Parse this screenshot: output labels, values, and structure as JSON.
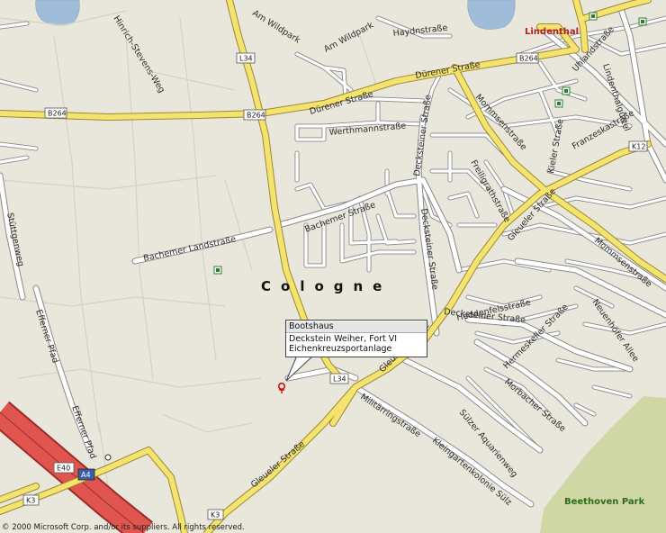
{
  "place": {
    "district": "Lindenthal",
    "city": "Cologne",
    "park": "Beethoven Park"
  },
  "callout": {
    "title": "Bootshaus",
    "line1": "Deckstein Weiher, Fort VI",
    "line2": "Eichenkreuzsportanlage"
  },
  "streets": {
    "haydn": "Haydnstraße",
    "am_wildpark_1": "Am Wildpark",
    "am_wildpark_2": "Am Wildpark",
    "hinrich": "Hinrich-Stevens-Weg",
    "dueren_1": "Dürener Straße",
    "dueren_2": "Dürener Straße",
    "wethmann": "Werthmannstraße",
    "deckstein_1": "Decksteiner Straße",
    "deckstein_2": "Decksteiner Straße",
    "deckstein_3": "Decksteiner Straße",
    "mommsen_1": "Mommsenstraße",
    "mommsen_2": "Mommsenstraße",
    "freiligrath": "Freiligrathstraße",
    "kieler": "Kieler Straße",
    "uhland": "Uhlandstraße",
    "lindenthal_guertel": "Lindenthalgürtel",
    "franzeska": "Franzeskastraße",
    "gleueler_1": "Gleueler Straße",
    "gleueler_2": "Gleueler Straße",
    "gleueler_3": "Gleueler Straße",
    "bachemer_1": "Bachemer Straße",
    "bachemer_landstr": "Bachemer Landstraße",
    "stueting": "Stüttgenweg",
    "efferner_1": "Efferner Pfad",
    "efferner_2": "Efferner Pfad",
    "heddenfels": "Heddenfelsstraße",
    "hermeskeller": "Hermeskeller Straße",
    "neuenhoefer": "Neuenhöfer Allee",
    "morbacher": "Morbacher Straße",
    "militaerring": "Militärringstraße",
    "suelzer": "Sülzer Aquarienweg",
    "kleingarten": "Kleingartenkolonie Sülz"
  },
  "shields": {
    "b264_w": "B264",
    "b264_m": "B264",
    "b264_e": "B264",
    "l34_n": "L34",
    "l34_s": "L34",
    "k12": "K12",
    "k3_w": "K3",
    "k3_s": "K3",
    "e40": "E40",
    "a4": "A4"
  },
  "copyright": "© 2000 Microsoft Corp. and/or its suppliers. All rights reserved.",
  "colors": {
    "background": "#e9e6dc",
    "major_road": "#f4e36e",
    "minor_road": "#ffffff",
    "motorway": "#e0554f",
    "water": "#9fbcd8",
    "park": "#cfd8a4",
    "district_label": "#b02020",
    "park_label": "#2e6b1d",
    "poi_icon": "#cc1111"
  }
}
